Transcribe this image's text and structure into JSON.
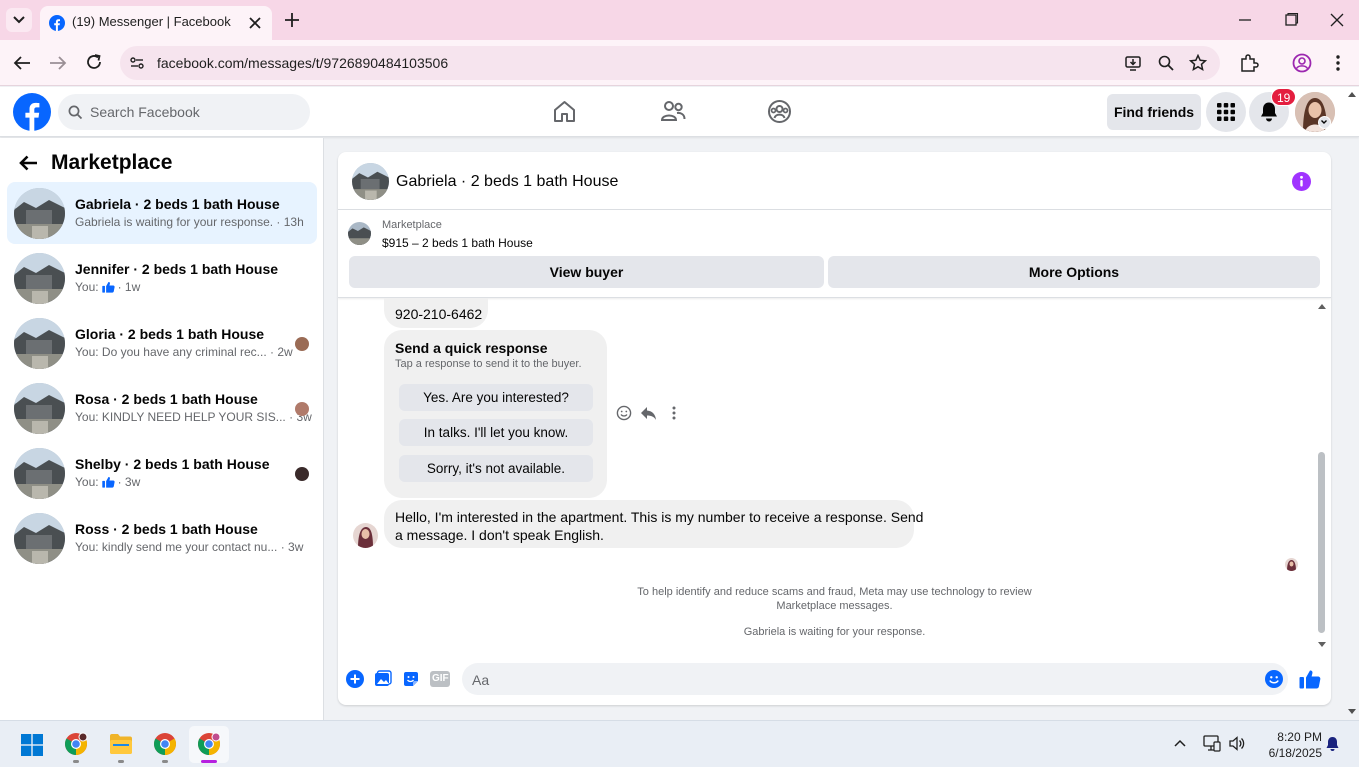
{
  "browser": {
    "tab_title": "(19) Messenger | Facebook",
    "url": "facebook.com/messages/t/9726890484103506"
  },
  "fb_header": {
    "search_placeholder": "Search Facebook",
    "find_friends": "Find friends",
    "notification_count": "19"
  },
  "sidebar": {
    "title": "Marketplace",
    "conversations": [
      {
        "name": "Gabriela · 2 beds 1 bath House",
        "preview": "Gabriela is waiting for your response. · 13h",
        "time": "",
        "active": true
      },
      {
        "name": "Jennifer · 2 beds 1 bath House",
        "preview": "You:",
        "time": "· 1w",
        "active": false
      },
      {
        "name": "Gloria · 2 beds 1 bath House",
        "preview": "You: Do you have any criminal rec...",
        "time": "· 2w",
        "active": false
      },
      {
        "name": "Rosa · 2 beds 1 bath House",
        "preview": "You: KINDLY NEED HELP YOUR SIS...",
        "time": "· 3w",
        "active": false
      },
      {
        "name": "Shelby · 2 beds 1 bath House",
        "preview": "You:",
        "time": "· 3w",
        "active": false
      },
      {
        "name": "Ross · 2 beds 1 bath House",
        "preview": "You: kindly send me your contact nu...",
        "time": "· 3w",
        "active": false
      }
    ]
  },
  "chat": {
    "title": "Gabriela · 2 beds 1 bath House",
    "listing_label": "Marketplace",
    "listing_price": "$915 – 2 beds 1 bath House",
    "view_buyer": "View buyer",
    "more_options": "More Options",
    "phone_message": "920-210-6462",
    "quick_response_title": "Send a quick response",
    "quick_response_subtitle": "Tap a response to send it to the buyer.",
    "quick_responses": [
      "Yes. Are you interested?",
      "In talks. I'll let you know.",
      "Sorry, it's not available."
    ],
    "message_line1": "Hello, I'm interested in the apartment. This is my number to receive a response. Send",
    "message_line2": "a message. I don't speak English.",
    "scam_notice_line1": "To help identify and reduce scams and fraud, Meta may use technology to review",
    "scam_notice_line2": "Marketplace messages.",
    "waiting_notice": "Gabriela is waiting for your response.",
    "composer_placeholder": "Aa",
    "gif_label": "GIF"
  },
  "taskbar": {
    "time": "8:20 PM",
    "date": "6/18/2025"
  },
  "colors": {
    "fb_blue": "#0866ff",
    "tab_strip": "#f7d7e7",
    "active_conversation": "#e7f3ff",
    "info_purple": "#a033ff"
  }
}
